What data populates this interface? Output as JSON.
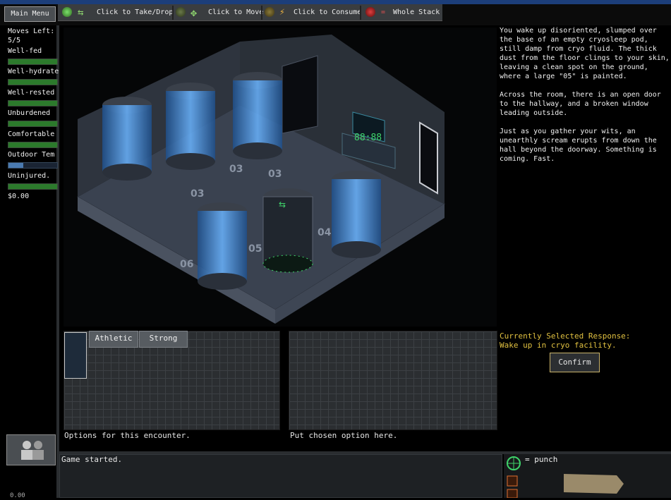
{
  "top_bar": {
    "main_menu_label": "Main Menu",
    "legend": [
      {
        "icon": "arrows-take-drop-icon",
        "label": "Click to Take/Drop"
      },
      {
        "icon": "move-arrows-icon",
        "label": "Click to Move"
      },
      {
        "icon": "consume-icon",
        "label": "Click to Consume"
      },
      {
        "icon": "equals-icon",
        "label": "Whole Stack"
      }
    ]
  },
  "stats": {
    "moves_left_label": "Moves Left:",
    "moves_left_value": "5/5",
    "conditions": [
      {
        "label": "Well-fed",
        "level": 1.0
      },
      {
        "label": "Well-hydrate",
        "level": 1.0
      },
      {
        "label": "Well-rested",
        "level": 1.0
      },
      {
        "label": "Unburdened",
        "level": 1.0
      },
      {
        "label": "Comfortable",
        "level": 1.0
      },
      {
        "label": "Outdoor Tem",
        "level": 0.3
      },
      {
        "label": "Uninjured.",
        "level": 1.0
      }
    ],
    "money": "$0.00",
    "money_bottom": "0.00"
  },
  "scene": {
    "pod_numbers": [
      "03",
      "03",
      "03",
      "04",
      "05",
      "06"
    ],
    "console_readout": "88:88"
  },
  "narration": {
    "paragraphs": [
      "You wake up disoriented, slumped over the base of an empty cryosleep pod, still damp from cryo fluid. The thick dust from the floor clings to your skin, leaving a clean spot on the ground, where a large \"05\" is painted.",
      "Across the room, there is an open door to the hallway, and a broken window leading outside.",
      "Just as you gather your wits, an unearthly scream erupts from down the hall beyond the doorway. Something is coming. Fast."
    ]
  },
  "encounter": {
    "tags": [
      "Athletic",
      "Strong"
    ],
    "options_caption": "Options for this encounter.",
    "chosen_caption": "Put chosen option here."
  },
  "response": {
    "label": "Currently Selected Response:",
    "value": "Wake up in cryo facility.",
    "confirm_label": "Confirm"
  },
  "log": {
    "text": "Game started."
  },
  "combat": {
    "punch_label": "= punch"
  },
  "colors": {
    "accent_green": "#2c7a2c",
    "response_yellow": "#e0c040",
    "pod_glow": "#4a8fd8"
  }
}
